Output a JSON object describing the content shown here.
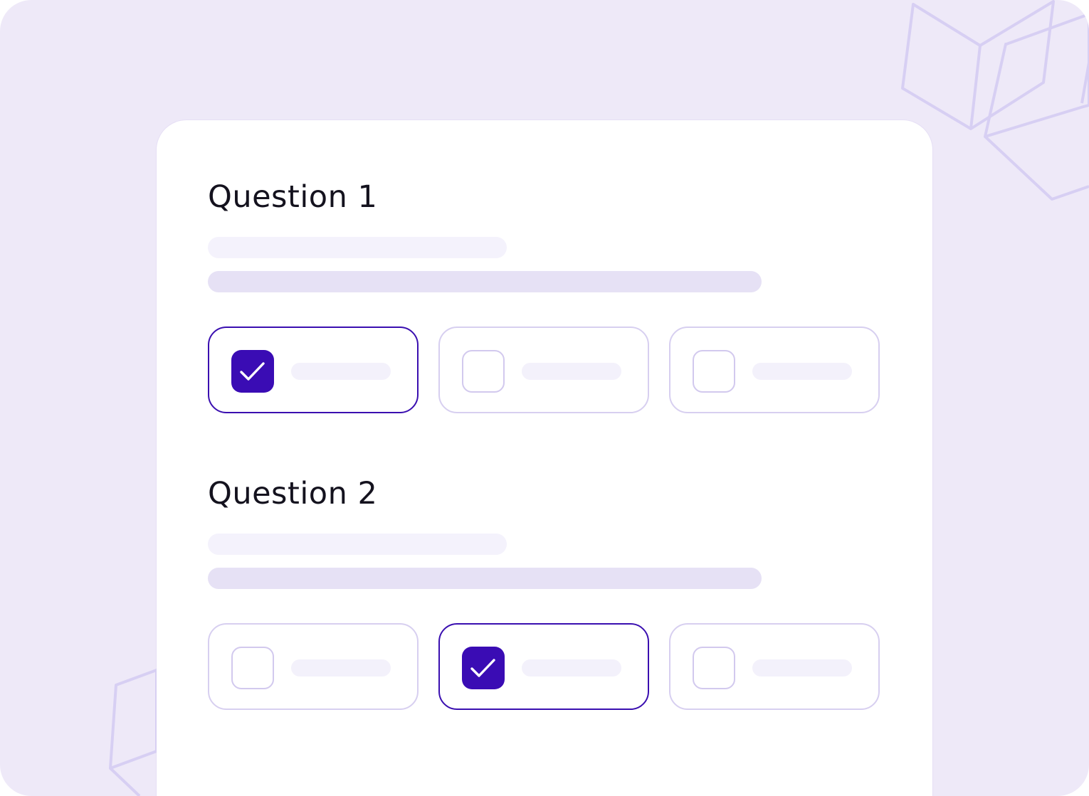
{
  "theme": {
    "background": "#EEE9F8",
    "card": "#FFFFFF",
    "accent": "#3A0CB4",
    "option_border": "#D7CFF0",
    "decor_stroke": "#D7CFF3"
  },
  "questions": [
    {
      "title": "Question 1",
      "options": [
        {
          "checked": true,
          "icon": "check-icon"
        },
        {
          "checked": false
        },
        {
          "checked": false
        }
      ]
    },
    {
      "title": "Question 2",
      "options": [
        {
          "checked": false
        },
        {
          "checked": true,
          "icon": "check-icon"
        },
        {
          "checked": false
        }
      ]
    }
  ],
  "decor": {
    "top_right": "outline-cubes-icon",
    "bottom_left": "outline-cube-icon"
  }
}
